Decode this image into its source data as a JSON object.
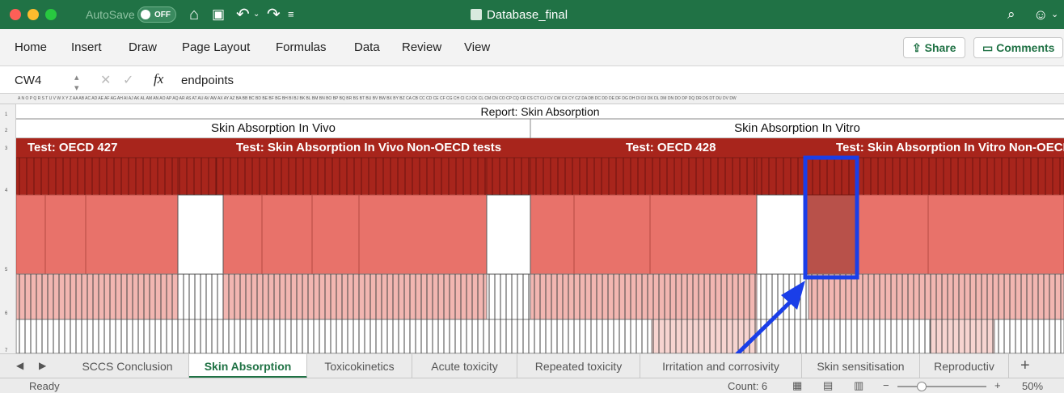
{
  "titlebar": {
    "autosave_label": "AutoSave",
    "autosave_state": "OFF",
    "document_title": "Database_final",
    "home_icon": "home-icon",
    "save_icon": "save-icon",
    "undo_icon": "undo-icon",
    "redo_icon": "redo-icon",
    "customize_icon": "customize-toolbar-icon",
    "search_icon": "search-icon",
    "account_icon": "smiley-icon"
  },
  "ribbon": {
    "tabs": [
      "Home",
      "Insert",
      "Draw",
      "Page Layout",
      "Formulas",
      "Data",
      "Review",
      "View"
    ],
    "share_label": "Share",
    "comments_label": "Comments"
  },
  "formula_bar": {
    "name_box": "CW4",
    "fx_label": "fx",
    "value": "endpoints"
  },
  "sheet": {
    "report_title": "Report: Skin Absorption",
    "in_vivo_label": "Skin Absorption In Vivo",
    "in_vitro_label": "Skin Absorption In Vitro",
    "test_oecd427": "Test: OECD 427",
    "test_vivo_non_oecd": "Test: Skin Absorption In Vivo Non-OECD tests",
    "test_oecd428": "Test: OECD 428",
    "test_vitro_non_oecd": "Test: Skin Absorption In Vitro Non-OECD",
    "row_numbers": [
      "1",
      "2",
      "3",
      "4",
      "5",
      "6",
      "7"
    ],
    "column_letters": "A N O P Q R S T U V W X Y Z AA AB AC AD AE AF AG AH AI AJ AK AL AM AN AO AP AQ AR AS AT AU AV AW AX AY AZ BA BB BC BD BE BF BG BH BI BJ BK BL BM BN BO BP BQ BR BS BT BU BV BW BX BY BZ CA CB CC CD CE CF CG CH CI CJ CK CL CM CN CO CP CQ CR CS CT CU CV CW CX CY CZ DA DB DC DD DE DF DG DH DI DJ DK DL DM DN DO DP DQ DR DS DT DU DV DW",
    "colors": {
      "dark_red": "#a8251c",
      "mid_red": "#e8726a",
      "light_pink": "#f2b6b1",
      "highlight_blue": "#1a3ee8"
    }
  },
  "sheet_tabs": [
    {
      "label": "SCCS Conclusion",
      "active": false
    },
    {
      "label": "Skin Absorption",
      "active": true
    },
    {
      "label": "Toxicokinetics",
      "active": false
    },
    {
      "label": "Acute toxicity",
      "active": false
    },
    {
      "label": "Repeated toxicity",
      "active": false
    },
    {
      "label": "Irritation and corrosivity",
      "active": false
    },
    {
      "label": "Skin sensitisation",
      "active": false
    },
    {
      "label": "Reproductiv",
      "active": false
    }
  ],
  "add_sheet_label": "+",
  "status": {
    "ready": "Ready",
    "count": "Count: 6",
    "zoom": "50%",
    "zoom_minus": "−",
    "zoom_plus": "+"
  }
}
